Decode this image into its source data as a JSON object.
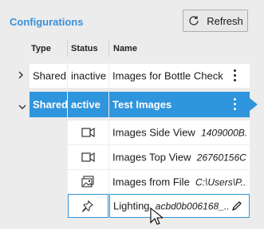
{
  "panel": {
    "title": "Configurations"
  },
  "toolbar": {
    "refresh_label": "Refresh",
    "refresh_icon": "refresh-icon"
  },
  "columns": {
    "type": "Type",
    "status": "Status",
    "name": "Name"
  },
  "rows": [
    {
      "type": "Shared",
      "status": "inactive",
      "name": "Images for Bottle Check",
      "expanded": false,
      "selected": false
    },
    {
      "type": "Shared",
      "status": "active",
      "name": "Test Images",
      "expanded": true,
      "selected": true
    }
  ],
  "children": [
    {
      "icon": "camera-icon",
      "name": "Images Side View",
      "detail": "1409000B..."
    },
    {
      "icon": "camera-icon",
      "name": "Images Top View",
      "detail": "26760156C..."
    },
    {
      "icon": "image-file-icon",
      "name": "Images from File",
      "detail": "C:\\Users\\P..."
    },
    {
      "icon": "pin-icon",
      "name": "Lighting",
      "detail": "acbd0b006168_..."
    }
  ],
  "colors": {
    "accent": "#2f95dc",
    "title": "#3a8fd6",
    "background": "#ececec"
  }
}
